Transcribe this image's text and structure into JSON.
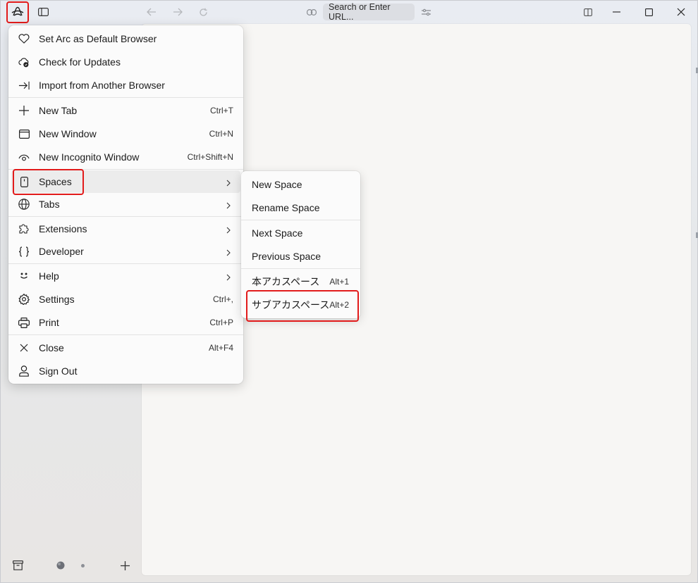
{
  "titlebar": {
    "url_placeholder": "Search or Enter URL..."
  },
  "menu": {
    "items": [
      {
        "label": "Set Arc as Default Browser",
        "shortcut": ""
      },
      {
        "label": "Check for Updates",
        "shortcut": ""
      },
      {
        "label": "Import from Another Browser",
        "shortcut": ""
      },
      {
        "label": "New Tab",
        "shortcut": "Ctrl+T"
      },
      {
        "label": "New Window",
        "shortcut": "Ctrl+N"
      },
      {
        "label": "New Incognito Window",
        "shortcut": "Ctrl+Shift+N"
      },
      {
        "label": "Spaces",
        "shortcut": ""
      },
      {
        "label": "Tabs",
        "shortcut": ""
      },
      {
        "label": "Extensions",
        "shortcut": ""
      },
      {
        "label": "Developer",
        "shortcut": ""
      },
      {
        "label": "Help",
        "shortcut": ""
      },
      {
        "label": "Settings",
        "shortcut": "Ctrl+,"
      },
      {
        "label": "Print",
        "shortcut": "Ctrl+P"
      },
      {
        "label": "Close",
        "shortcut": "Alt+F4"
      },
      {
        "label": "Sign Out",
        "shortcut": ""
      }
    ]
  },
  "submenu": {
    "items": [
      {
        "label": "New Space",
        "shortcut": ""
      },
      {
        "label": "Rename Space",
        "shortcut": ""
      },
      {
        "label": "Next Space",
        "shortcut": ""
      },
      {
        "label": "Previous Space",
        "shortcut": ""
      },
      {
        "label": "本アカスペース",
        "shortcut": "Alt+1"
      },
      {
        "label": "サブアカスペース",
        "shortcut": "Alt+2"
      }
    ]
  },
  "colors": {
    "highlight": "#e21b1b",
    "menu_bg": "#fbfbfb",
    "hover_bg": "#ececec"
  }
}
